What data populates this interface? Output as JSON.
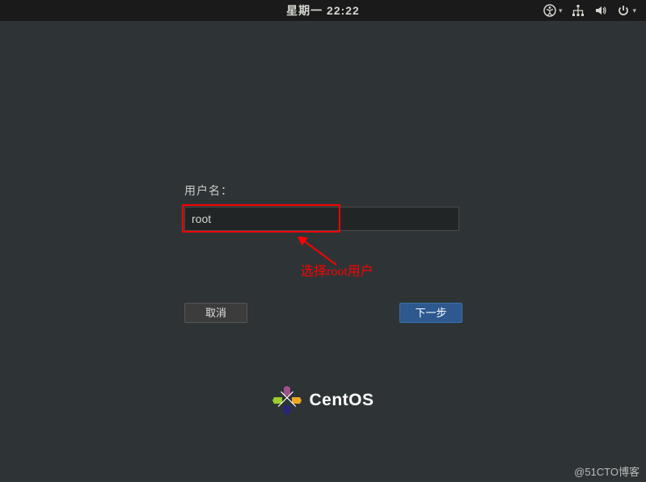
{
  "topbar": {
    "day": "星期一",
    "time": "22:22"
  },
  "icons": {
    "accessibility": "accessibility-icon",
    "network": "network-icon",
    "volume": "volume-icon",
    "power": "power-icon"
  },
  "login": {
    "username_label": "用户名：",
    "username_value": "root",
    "cancel_label": "取消",
    "next_label": "下一步"
  },
  "annotation": {
    "text": "选择root用户"
  },
  "footer": {
    "brand": "CentOS"
  },
  "watermark": "@51CTO博客"
}
